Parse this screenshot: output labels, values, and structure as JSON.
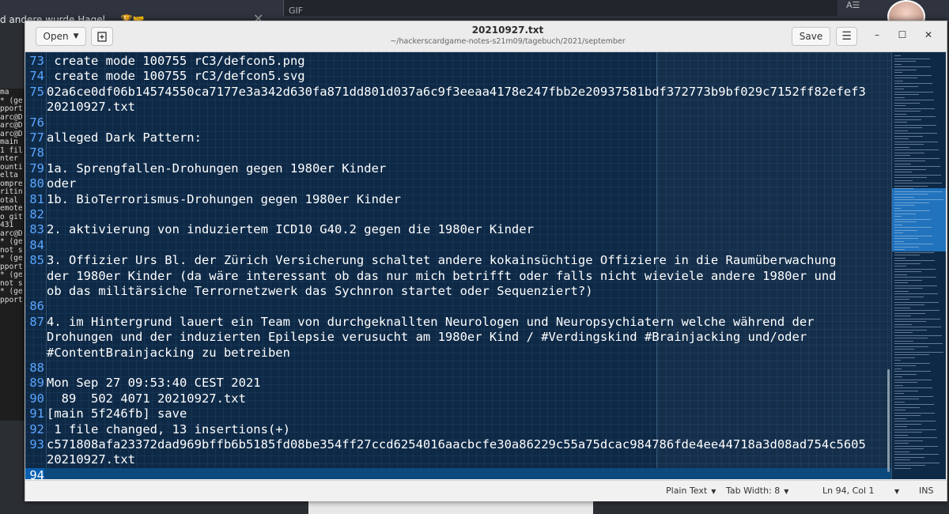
{
  "background": {
    "browser_tab_title": "d andere wurde Hagel … 🏆🤝",
    "gif_label": "GIF",
    "lang_label": "A☰",
    "terminal_lines": [
      "ma",
      "",
      "* (ge",
      "pport",
      "",
      "arc@D",
      "arc@D",
      "arc@D",
      "main ",
      "1 fil",
      "nter ",
      "ounti",
      "elta ",
      "ompre",
      "ritin",
      "otal ",
      "emote",
      "o git",
      "  431",
      "arc@D",
      "* (ge",
      "not s",
      "",
      "* (ge",
      "pport",
      "",
      "* (ge",
      "not s",
      "",
      "* (ge",
      "pport"
    ]
  },
  "header": {
    "open_label": "Open",
    "save_label": "Save",
    "title": "20210927.txt",
    "subtitle": "~/hackerscardgame-notes-s21m09/tagebuch/2021/september"
  },
  "editor": {
    "lines": [
      {
        "n": "73",
        "text": " create mode 100755 rC3/defcon5.png"
      },
      {
        "n": "74",
        "text": " create mode 100755 rC3/defcon5.svg"
      },
      {
        "n": "75",
        "text": "02a6ce0df06b14574550ca7177e3a342d630fa871dd801d037a6c9f3eeaa4178e247fbb2e20937581bdf372773b9bf029c7152ff82efef3"
      },
      {
        "n": "",
        "text": "20210927.txt"
      },
      {
        "n": "76",
        "text": ""
      },
      {
        "n": "77",
        "text": "alleged Dark Pattern:"
      },
      {
        "n": "78",
        "text": ""
      },
      {
        "n": "79",
        "text": "1a. Sprengfallen-Drohungen gegen 1980er Kinder"
      },
      {
        "n": "80",
        "text": "oder"
      },
      {
        "n": "81",
        "text": "1b. BioTerrorismus-Drohungen gegen 1980er Kinder"
      },
      {
        "n": "82",
        "text": ""
      },
      {
        "n": "83",
        "text": "2. aktivierung von induziertem ICD10 G40.2 gegen die 1980er Kinder"
      },
      {
        "n": "84",
        "text": ""
      },
      {
        "n": "85",
        "text": "3. Offizier Urs Bl. der Zürich Versicherung schaltet andere kokainsüchtige Offiziere in die Raumüberwachung"
      },
      {
        "n": "",
        "text": "der 1980er Kinder (da wäre interessant ob das nur mich betrifft oder falls nicht wieviele andere 1980er und"
      },
      {
        "n": "",
        "text": "ob das militärsiche Terrornetzwerk das Sychnron startet oder Sequenziert?)"
      },
      {
        "n": "86",
        "text": ""
      },
      {
        "n": "87",
        "text": "4. im Hintergrund lauert ein Team von durchgeknallten Neurologen und Neuropsychiatern welche während der"
      },
      {
        "n": "",
        "text": "Drohungen und der induzierten Epilepsie verusucht am 1980er Kind / #Verdingskind #Brainjacking und/oder"
      },
      {
        "n": "",
        "text": "#ContentBrainjacking zu betreiben"
      },
      {
        "n": "88",
        "text": ""
      },
      {
        "n": "89",
        "text": "Mon Sep 27 09:53:40 CEST 2021"
      },
      {
        "n": "90",
        "text": "  89  502 4071 20210927.txt"
      },
      {
        "n": "91",
        "text": "[main 5f246fb] save"
      },
      {
        "n": "92",
        "text": " 1 file changed, 13 insertions(+)"
      },
      {
        "n": "93",
        "text": "c571808afa23372dad969bffb6b5185fd08be354ff27ccd6254016aacbcfe30a86229c55a75dcac984786fde4ee44718a3d08ad754c5605"
      },
      {
        "n": "",
        "text": "20210927.txt"
      },
      {
        "n": "94",
        "text": ""
      }
    ]
  },
  "statusbar": {
    "language": "Plain Text",
    "tab_width": "Tab Width: 8",
    "position": "Ln 94, Col 1",
    "mode": "INS"
  },
  "colors": {
    "editor_bg": "#0e2946",
    "line_number": "#5aa6ff",
    "current_line": "#0c4a7d"
  }
}
